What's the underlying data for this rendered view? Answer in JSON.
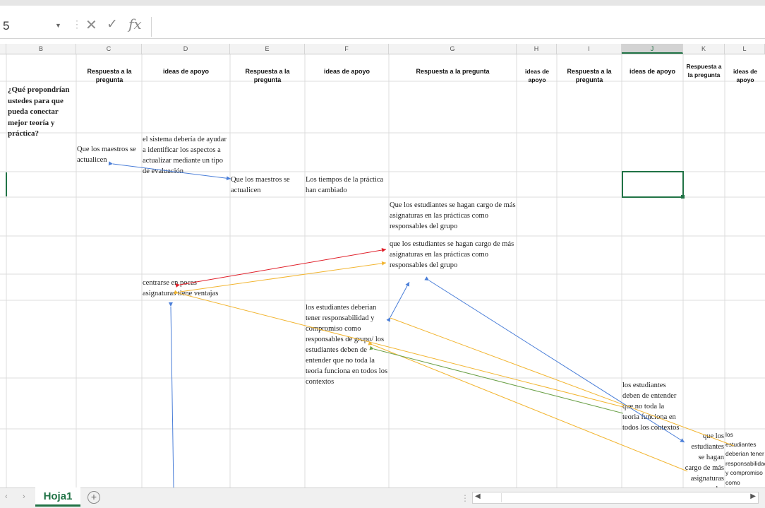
{
  "formula_bar": {
    "name_box": "5",
    "cancel_glyph": "✕",
    "enter_glyph": "✓",
    "fx_label": "fx",
    "formula_value": ""
  },
  "columns": [
    "B",
    "C",
    "D",
    "E",
    "F",
    "G",
    "H",
    "I",
    "J",
    "K",
    "L"
  ],
  "selected_column": "J",
  "header_row": {
    "c": "Respuesta a la pregunta",
    "d": "ideas de apoyo",
    "e": "Respuesta a la pregunta",
    "f": "ideas de apoyo",
    "g": "Respuesta a la pregunta",
    "h": "ideas de apoyo",
    "i": "Respuesta a la pregunta",
    "j": "ideas de apoyo",
    "k": "Respuesta a la pregunta",
    "l": "ideas de apoyo"
  },
  "cells": {
    "question_b": "¿Qué propondrían ustedes para que pueda conectar mejor teoría y práctica?",
    "c_row3": "Que los maestros se actualicen",
    "d_row3": "el sistema debería de ayudar a identificar los aspectos a actualizar mediante un tipo de evaluación",
    "e_row4": "Que los maestros se actualicen",
    "f_row4": "Los tiempos de la práctica han cambiado",
    "g_row5": "Que los estudiantes se hagan cargo de más asignaturas en las prácticas como responsables del grupo",
    "g_row6": "que los estudiantes se hagan cargo de más asignaturas en las prácticas como responsables del grupo",
    "d_row7": "centrarse en pocas asignaturas tiene ventajas",
    "f_row8": "los estudiantes deberian tener responsabilidad y compromiso como responsables de grupo/ los estudiantes deben de entender que no toda la teoria funciona en todos los contextos",
    "j_row9": "los estudiantes deben de entender que no toda la teoria funciona en todos los contextos",
    "k_row10": "que los estudiantes se hagan cargo de más asignaturas en las prácticas",
    "l_row10": "los estudiantes deberian tener responsabilidad y compromiso como"
  },
  "sheet_tabs": [
    "Hoja1"
  ],
  "tab_nav": {
    "prev": "‹",
    "next": "›",
    "add": "+"
  },
  "arrow_colors": {
    "blue": "#4a7ed8",
    "orange": "#f2b531",
    "red": "#e0202a",
    "green": "#6da24b"
  },
  "selection_color": "#217346"
}
